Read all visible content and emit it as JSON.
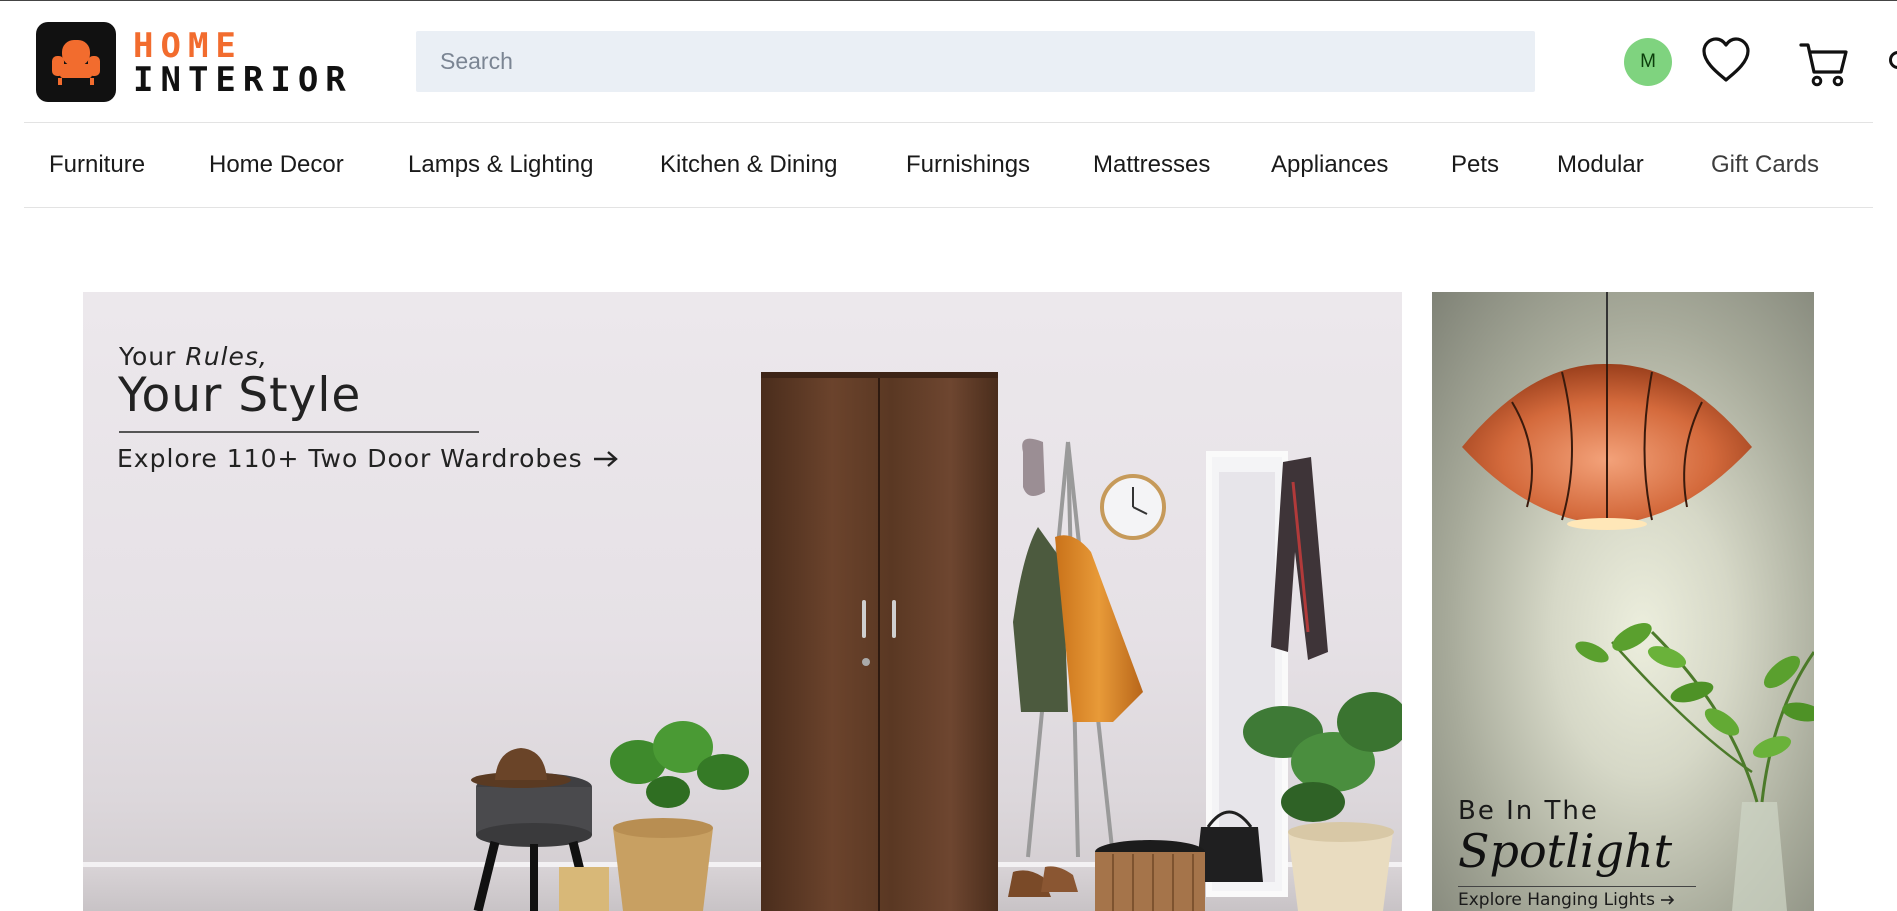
{
  "brand": {
    "line1": "HOME",
    "line2": "INTERIOR"
  },
  "search": {
    "placeholder": "Search",
    "value": ""
  },
  "user": {
    "initial": "M"
  },
  "nav": {
    "items": [
      {
        "label": "Furniture"
      },
      {
        "label": "Home Decor"
      },
      {
        "label": "Lamps & Lighting"
      },
      {
        "label": "Kitchen & Dining"
      },
      {
        "label": "Furnishings"
      },
      {
        "label": "Mattresses"
      },
      {
        "label": "Appliances"
      },
      {
        "label": "Pets"
      },
      {
        "label": "Modular"
      },
      {
        "label": "Gift Cards"
      }
    ]
  },
  "hero": {
    "eyebrow_prefix": "Your ",
    "eyebrow_emphasis": "Rules,",
    "title": "Your Style",
    "cta": "Explore 110+ Two Door Wardrobes"
  },
  "side_banner": {
    "line1": "Be In The",
    "line2": "Spotlight",
    "cta": "Explore Hanging Lights"
  },
  "icons": {
    "logo": "armchair-icon",
    "search": "search-icon",
    "wishlist": "heart-icon",
    "cart": "cart-icon",
    "arrow": "arrow-right-icon"
  },
  "colors": {
    "brand_accent": "#f26c2e",
    "avatar_bg": "#7fd37f",
    "search_bg": "#eaeff5"
  }
}
